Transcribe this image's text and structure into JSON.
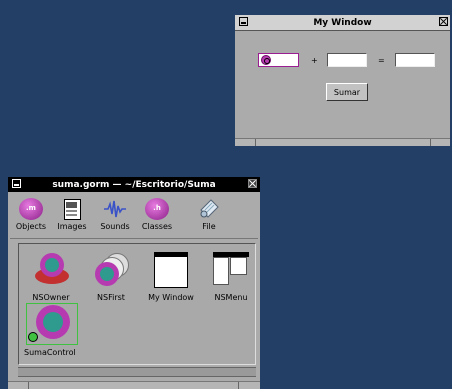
{
  "my_window": {
    "title": "My Window",
    "plus": "+",
    "equals": "=",
    "button": "Sumar"
  },
  "gorm_window": {
    "title": "suma.gorm — ~/Escritorio/Suma",
    "toolbar": [
      {
        "label": "Objects",
        "icon": "objects-icon",
        "glyph": ".m"
      },
      {
        "label": "Images",
        "icon": "images-icon"
      },
      {
        "label": "Sounds",
        "icon": "sounds-icon"
      },
      {
        "label": "Classes",
        "icon": "classes-icon",
        "glyph": ".h"
      },
      {
        "label": "File",
        "icon": "file-icon"
      }
    ],
    "objects": [
      {
        "label": "NSOwner"
      },
      {
        "label": "NSFirst"
      },
      {
        "label": "My Window"
      },
      {
        "label": "NSMenu"
      },
      {
        "label": "SumaControl"
      }
    ]
  },
  "colors": {
    "desktop": "#233f66",
    "accent": "#b63bb0",
    "ring": "#2f9a8e",
    "selection": "#3fc23f"
  }
}
